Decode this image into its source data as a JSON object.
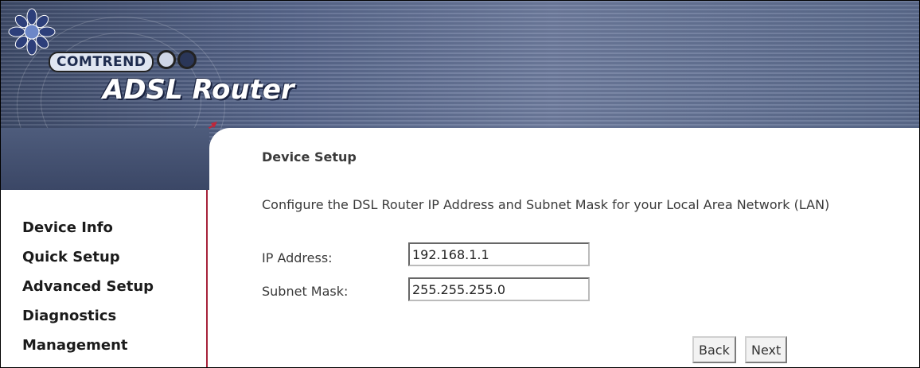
{
  "header": {
    "brand": "COMTREND",
    "product_prefix": "ADSL",
    "product_suffix": "Router"
  },
  "sidebar": {
    "items": [
      {
        "label": "Device Info"
      },
      {
        "label": "Quick Setup"
      },
      {
        "label": "Advanced Setup"
      },
      {
        "label": "Diagnostics"
      },
      {
        "label": "Management"
      }
    ]
  },
  "main": {
    "title": "Device Setup",
    "description": "Configure the DSL Router IP Address and Subnet Mask for your Local Area Network (LAN)",
    "ip_label": "IP Address:",
    "ip_value": "192.168.1.1",
    "subnet_label": "Subnet Mask:",
    "subnet_value": "255.255.255.0",
    "back_label": "Back",
    "next_label": "Next"
  },
  "colors": {
    "sidebar_border": "#a7233a",
    "banner": "#56658a"
  }
}
